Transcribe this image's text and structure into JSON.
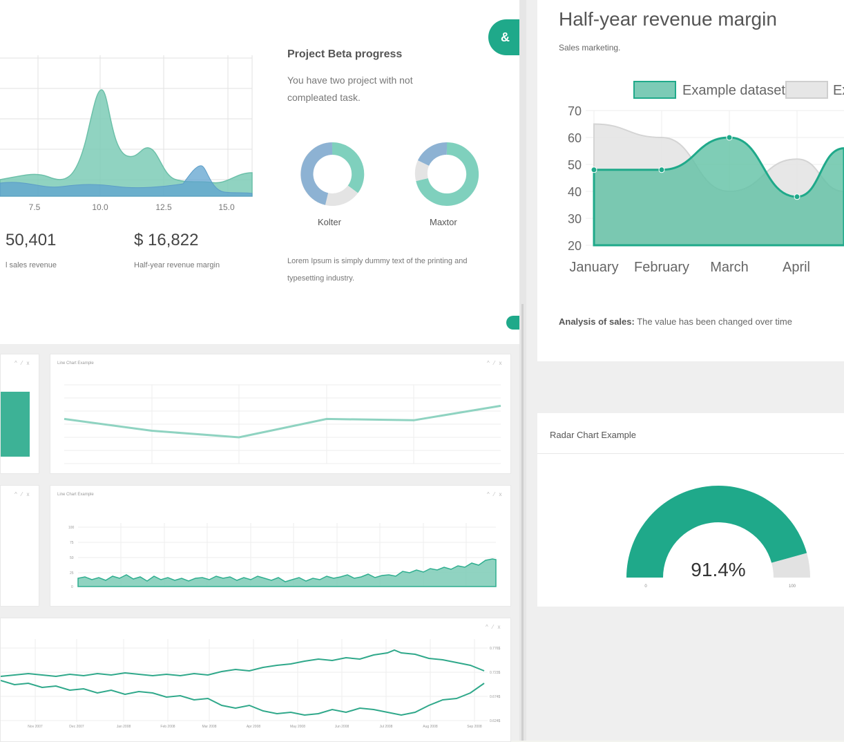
{
  "colors": {
    "teal": "#1fa98a",
    "teal_light": "#7ccbb6",
    "blue": "#7aa7cf",
    "grey_fill": "#e2e2e2",
    "bg": "#f3f4ef"
  },
  "top_left": {
    "x_ticks": [
      "7.5",
      "10.0",
      "12.5",
      "15.0"
    ],
    "stat1_value": "50,401",
    "stat1_label": "l sales revenue",
    "stat2_value": "$ 16,822",
    "stat2_label": "Half-year revenue margin"
  },
  "project_beta": {
    "title": "Project Beta progress",
    "description": "You have two project with not compleated task.",
    "donut1_label": "Kolter",
    "donut2_label": "Maxtor",
    "footer": "Lorem Ipsum is simply dummy text of the printing and typesetting industry.",
    "fab_icon": "link-icon"
  },
  "revenue_chart_card": {
    "title": "Half-year revenue margin",
    "subtitle": "Sales marketing.",
    "analysis_label": "Analysis of sales:",
    "analysis_text": " The value has been changed over time"
  },
  "chart_data": [
    {
      "type": "area",
      "legend": [
        "Example dataset",
        "Ex"
      ],
      "categories": [
        "January",
        "February",
        "March",
        "April"
      ],
      "y_ticks": [
        "70",
        "60",
        "50",
        "40",
        "30",
        "20"
      ],
      "ylim": [
        20,
        70
      ],
      "series": [
        {
          "name": "Example dataset",
          "values": [
            48,
            48,
            60,
            38
          ]
        },
        {
          "name": "Ex",
          "values": [
            65,
            60,
            40,
            52
          ]
        }
      ]
    },
    {
      "type": "line",
      "title": "Line Chart Example",
      "series": [
        {
          "values": [
            34,
            25,
            20,
            34,
            33,
            44
          ]
        }
      ]
    },
    {
      "type": "area",
      "title": "Line Chart Example",
      "y_ticks": [
        "100",
        "75",
        "50",
        "25",
        "0"
      ]
    },
    {
      "type": "line",
      "x_ticks": [
        "Nov 2007",
        "Dec 2007",
        "Jan 2008",
        "Feb 2008",
        "Mar 2008",
        "Apr 2008",
        "May 2008",
        "Jun 2008",
        "Jul 2008",
        "Aug 2008",
        "Sep 2008"
      ],
      "y_ticks": [
        "0.776$",
        "0.723$",
        "0.674$",
        "0.624$"
      ]
    }
  ],
  "radar_card": {
    "title": "Radar Chart Example",
    "gauge_value": "91.4%",
    "gauge_fraction": 0.914,
    "gauge_min": "0",
    "gauge_max": "100"
  }
}
